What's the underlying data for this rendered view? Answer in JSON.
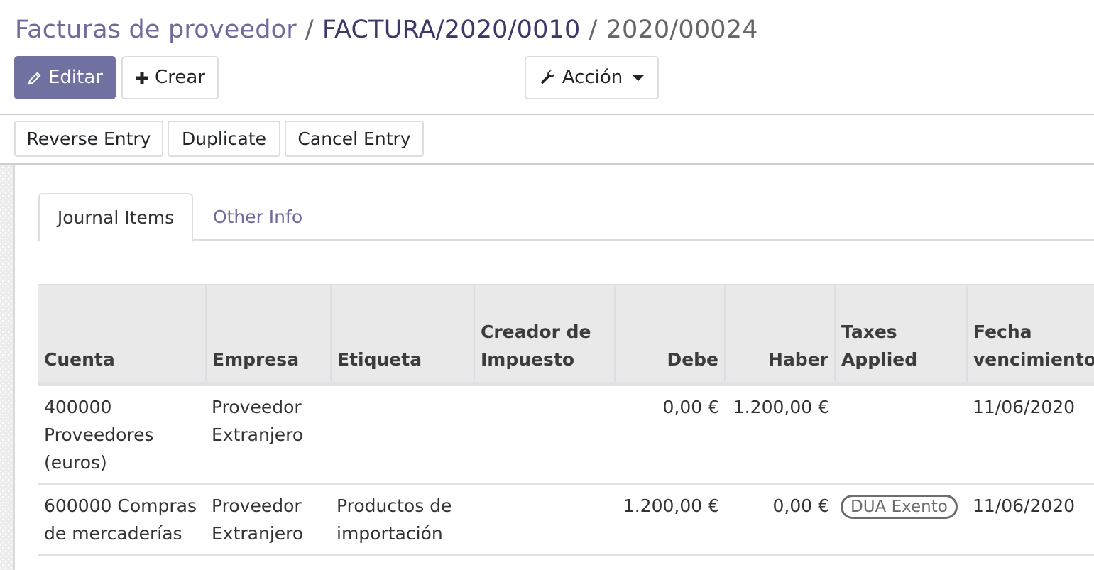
{
  "breadcrumb": {
    "items": [
      "Facturas de proveedor",
      "FACTURA/2020/0010",
      "2020/00024"
    ],
    "separator": "/"
  },
  "toolbar": {
    "edit_label": "Editar",
    "create_label": "Crear",
    "action_label": "Acción"
  },
  "statusbar": {
    "buttons": [
      "Reverse Entry",
      "Duplicate",
      "Cancel Entry"
    ]
  },
  "tabs": [
    {
      "label": "Journal Items",
      "active": true
    },
    {
      "label": "Other Info",
      "active": false
    }
  ],
  "table": {
    "columns": [
      "Cuenta",
      "Empresa",
      "Etiqueta",
      "Creador de Impuesto",
      "Debe",
      "Haber",
      "Taxes Applied",
      "Fecha vencimiento"
    ],
    "rows": [
      {
        "cuenta": "400000 Proveedores (euros)",
        "empresa": "Proveedor Extranjero",
        "etiqueta": "",
        "creador": "",
        "debe": "0,00 €",
        "haber": "1.200,00 €",
        "taxes": "",
        "fecha": "11/06/2020"
      },
      {
        "cuenta": "600000 Compras de mercaderías",
        "empresa": "Proveedor Extranjero",
        "etiqueta": "Productos de importación",
        "creador": "",
        "debe": "1.200,00 €",
        "haber": "0,00 €",
        "taxes": "DUA Exento",
        "fecha": "11/06/2020"
      }
    ]
  },
  "colors": {
    "brand": "#7070a1",
    "link": "#6f6b9d"
  }
}
